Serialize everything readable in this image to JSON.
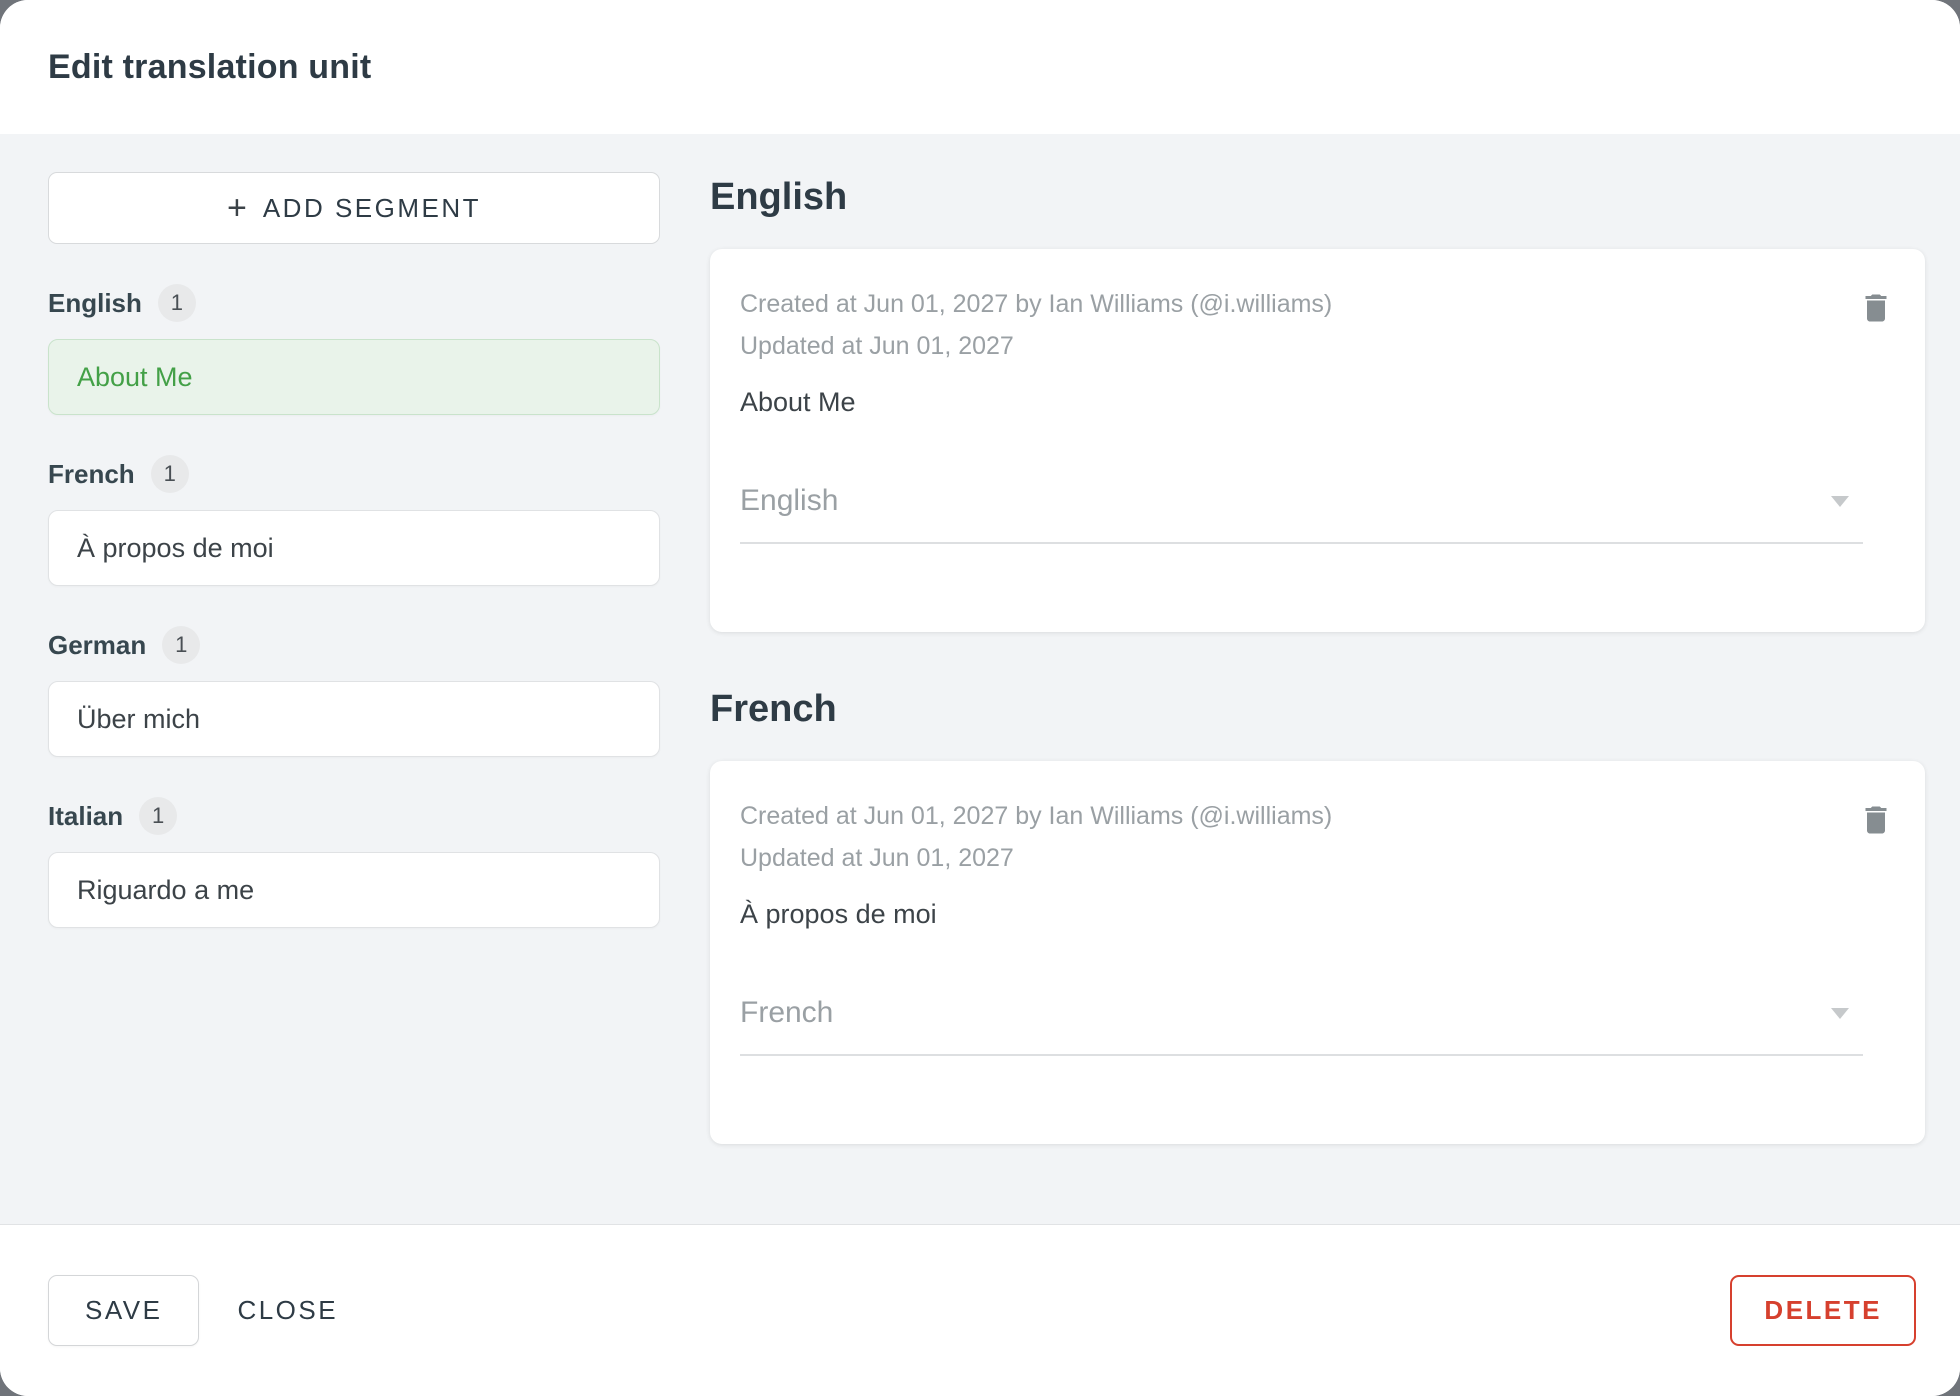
{
  "modal": {
    "title": "Edit translation unit"
  },
  "sidebar": {
    "add_segment": {
      "icon": "+",
      "label": "ADD SEGMENT"
    },
    "groups": [
      {
        "language": "English",
        "count": "1",
        "segment": "About Me"
      },
      {
        "language": "French",
        "count": "1",
        "segment": "À propos de moi"
      },
      {
        "language": "German",
        "count": "1",
        "segment": "Über mich"
      },
      {
        "language": "Italian",
        "count": "1",
        "segment": "Riguardo a me"
      }
    ]
  },
  "details": [
    {
      "heading": "English",
      "created": "Created at Jun 01, 2027 by Ian Williams (@i.williams)",
      "updated": "Updated at Jun 01, 2027",
      "text": "About Me",
      "language": "English"
    },
    {
      "heading": "French",
      "created": "Created at Jun 01, 2027 by Ian Williams (@i.williams)",
      "updated": "Updated at Jun 01, 2027",
      "text": "À propos de moi",
      "language": "French"
    }
  ],
  "footer": {
    "save": "SAVE",
    "close": "CLOSE",
    "delete": "DELETE"
  },
  "colors": {
    "active_segment_green": "#43a047",
    "active_segment_bg": "#e9f3ea",
    "delete_red": "#d6402e",
    "body_gray": "#f2f4f6"
  }
}
